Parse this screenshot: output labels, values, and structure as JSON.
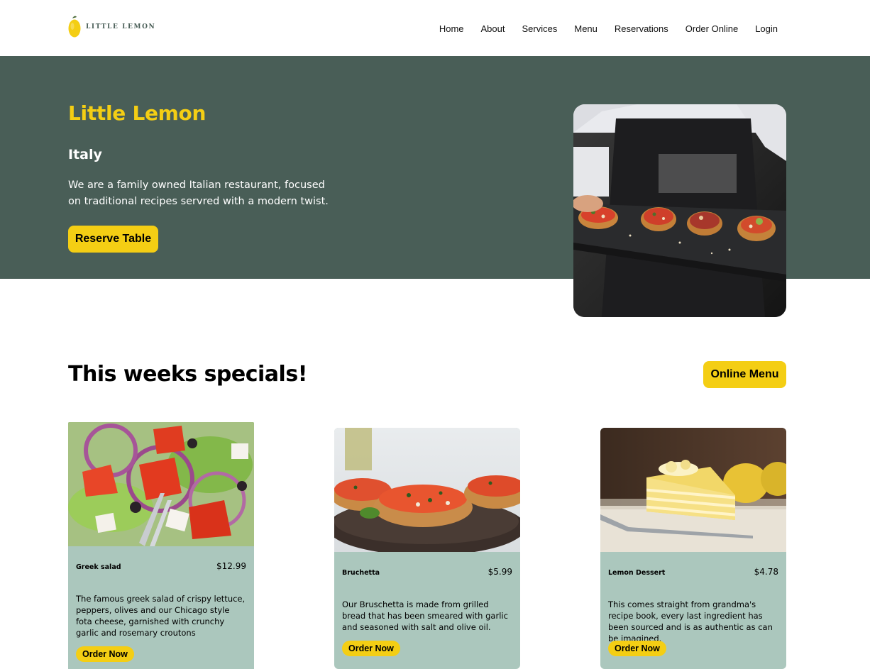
{
  "header": {
    "logo_text": "LITTLE LEMON",
    "nav": [
      "Home",
      "About",
      "Services",
      "Menu",
      "Reservations",
      "Order Online",
      "Login"
    ]
  },
  "hero": {
    "title": "Little Lemon",
    "subtitle": "Italy",
    "description": "We are a family owned Italian restaurant, focused on traditional recipes servred with a modern twist.",
    "cta_label": "Reserve Table"
  },
  "specials": {
    "title": "This weeks specials!",
    "menu_button_label": "Online Menu",
    "items": [
      {
        "name": "Greek salad",
        "price": "$12.99",
        "description": "The famous greek salad of crispy lettuce, peppers, olives and our Chicago style fota cheese, garnished with crunchy garlic and rosemary croutons",
        "button_label": "Order Now"
      },
      {
        "name": "Bruchetta",
        "price": "$5.99",
        "description": "Our Bruschetta is made from grilled bread that has been smeared with garlic and seasoned with salt and olive oil.",
        "button_label": "Order Now"
      },
      {
        "name": "Lemon Dessert",
        "price": "$4.78",
        "description": "This comes straight from grandma's recipe book, every last ingredient has been sourced and is as authentic as can be imagined.",
        "button_label": "Order Now"
      }
    ]
  },
  "colors": {
    "primary_green": "#495e57",
    "primary_yellow": "#f4ce14",
    "card_background": "#abc7bd"
  }
}
